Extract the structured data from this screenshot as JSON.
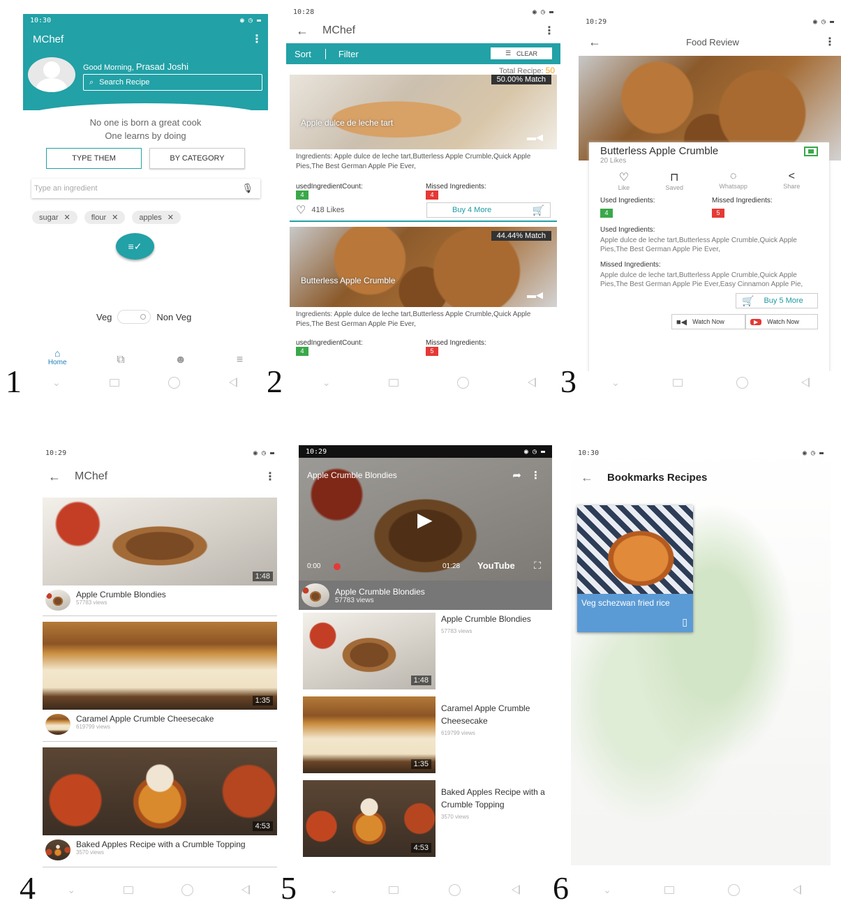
{
  "colors": {
    "teal": "#22a1a6",
    "green": "#3aa84a",
    "red": "#e53935",
    "orange": "#f5a623"
  },
  "labels": [
    "1",
    "2",
    "3",
    "4",
    "5",
    "6"
  ],
  "s1": {
    "time": "10:30",
    "app_title": "MChef",
    "greeting_prefix": "Good Morning, ",
    "user_name": "Prasad Joshi",
    "search_placeholder": "Search Recipe",
    "quote_line1": "No one is born a great cook",
    "quote_line2": "One learns by doing",
    "tab_type": "TYPE THEM",
    "tab_category": "BY CATEGORY",
    "ingredient_placeholder": "Type an ingredient",
    "chips": [
      "sugar",
      "flour",
      "apples"
    ],
    "veg_label": "Veg",
    "nonveg_label": "Non Veg",
    "nav_home": "Home"
  },
  "s2": {
    "time": "10:28",
    "title": "MChef",
    "sort": "Sort",
    "filter": "Filter",
    "clear": "CLEAR",
    "total_prefix": "Total Recipe: ",
    "total_value": "50",
    "ingredients_label": "Ingredients:",
    "used_label": "usedIngredientCount:",
    "missed_label": "Missed Ingredients:",
    "recipes": [
      {
        "match": "50.00% Match",
        "name": "Apple dulce de leche tart",
        "ingredients": "Ingredients: Apple dulce de leche tart,Butterless Apple Crumble,Quick Apple Pies,The Best German Apple Pie Ever,",
        "used": "4",
        "missed": "4",
        "likes": "418 Likes",
        "buy": "Buy 4 More"
      },
      {
        "match": "44.44% Match",
        "name": "Butterless Apple Crumble",
        "ingredients": "Ingredients: Apple dulce de leche tart,Butterless Apple Crumble,Quick Apple Pies,The Best German Apple Pie Ever,",
        "used": "4",
        "missed": "5"
      }
    ]
  },
  "s3": {
    "time": "10:29",
    "title": "Food Review",
    "recipe": "Butterless Apple Crumble",
    "likes": "20 Likes",
    "actions": [
      "Like",
      "Saved",
      "Whatsapp",
      "Share"
    ],
    "used_label": "Used Ingredients:",
    "missed_label": "Missed Ingredients:",
    "used_count": "4",
    "missed_count": "5",
    "used_heading": "Used Ingredients:",
    "used_text": "Apple dulce de leche tart,Butterless Apple Crumble,Quick Apple Pies,The Best German Apple Pie Ever,",
    "missed_heading": "Missed Ingredients:",
    "missed_text": "Apple dulce de leche tart,Butterless Apple Crumble,Quick Apple Pies,The Best German Apple Pie Ever,Easy Cinnamon Apple Pie,",
    "buy": "Buy 5 More",
    "watch1": "Watch Now",
    "watch2": "Watch Now"
  },
  "s4": {
    "time": "10:29",
    "title": "MChef",
    "videos": [
      {
        "title": "Apple Crumble Blondies",
        "views": "57783 views",
        "duration": "1:48"
      },
      {
        "title": "Caramel Apple Crumble Cheesecake",
        "views": "619799 views",
        "duration": "1:35"
      },
      {
        "title": "Baked Apples Recipe with a Crumble Topping",
        "views": "3570 views",
        "duration": "4:53"
      }
    ]
  },
  "s5": {
    "time": "10:29",
    "player_title": "Apple Crumble Blondies",
    "elapsed": "0:00",
    "total": "01:28",
    "youtube": "YouTube",
    "now_title": "Apple Crumble Blondies",
    "now_views": "57783 views",
    "list": [
      {
        "title": "Apple Crumble Blondies",
        "views": "57783 views",
        "duration": "1:48"
      },
      {
        "title": "Caramel Apple Crumble Cheesecake",
        "views": "619799 views",
        "duration": "1:35"
      },
      {
        "title": "Baked Apples Recipe with a Crumble Topping",
        "views": "3570 views",
        "duration": "4:53"
      }
    ]
  },
  "s6": {
    "time": "10:30",
    "title": "Bookmarks Recipes",
    "card_title": "Veg schezwan fried rice"
  }
}
